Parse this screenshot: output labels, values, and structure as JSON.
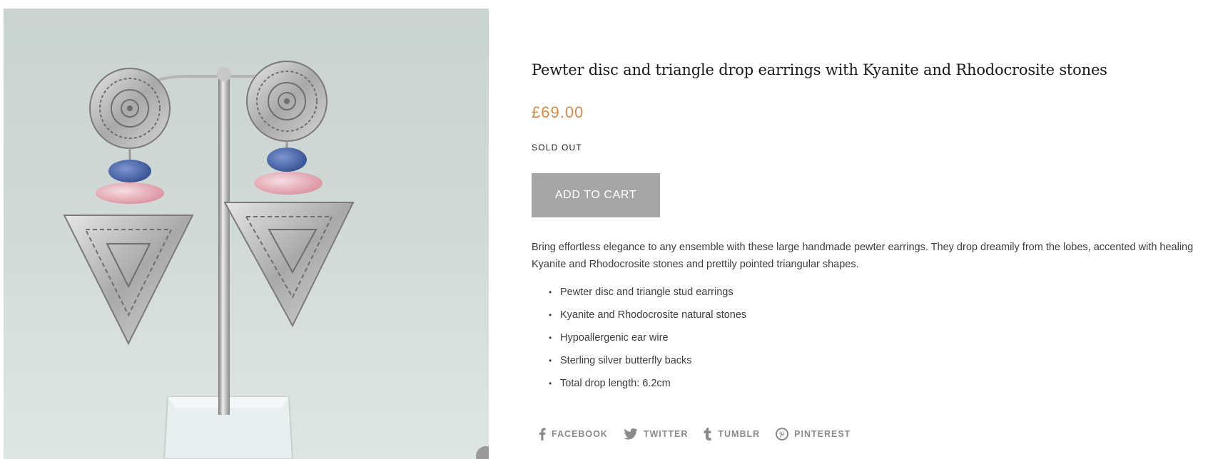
{
  "product": {
    "title": "Pewter disc and triangle drop earrings with Kyanite and Rhodocrosite stones",
    "price": "£69.00",
    "stock_status": "SOLD OUT",
    "add_to_cart_label": "ADD TO CART",
    "description": "Bring effortless elegance to any ensemble with these large handmade pewter earrings. They drop dreamily from the lobes, accented with healing Kyanite and Rhodocrosite stones and prettily pointed triangular shapes.",
    "features": [
      "Pewter disc and triangle stud earrings",
      "Kyanite and Rhodocrosite natural stones",
      "Hypoallergenic ear wire",
      "Sterling silver butterfly backs",
      "Total drop length: 6.2cm"
    ]
  },
  "share": [
    {
      "label": "FACEBOOK",
      "icon": "facebook-icon"
    },
    {
      "label": "TWITTER",
      "icon": "twitter-icon"
    },
    {
      "label": "TUMBLR",
      "icon": "tumblr-icon"
    },
    {
      "label": "PINTEREST",
      "icon": "pinterest-icon"
    }
  ],
  "colors": {
    "price": "#d08a4a",
    "button_bg": "#a6a6a6",
    "share_text": "#8a8a8a"
  }
}
